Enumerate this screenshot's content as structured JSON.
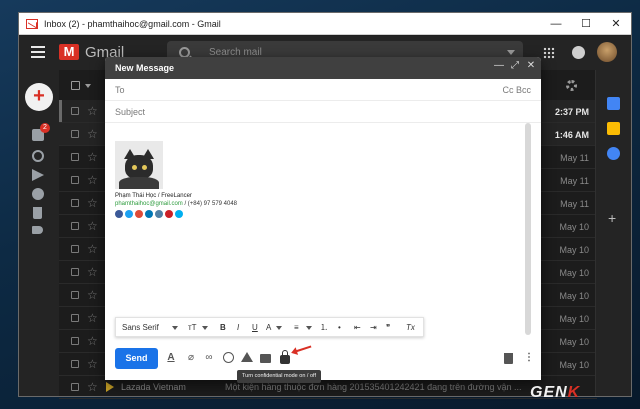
{
  "window": {
    "title": "Inbox (2) - phamthaihoc@gmail.com - Gmail"
  },
  "gmail": {
    "logo_text": "Gmail",
    "search_placeholder": "Search mail",
    "inbox_badge": "2"
  },
  "inbox": {
    "rows": [
      {
        "date": "2:37 PM",
        "unread": true
      },
      {
        "date": "1:46 AM",
        "unread": true
      },
      {
        "date": "May 11",
        "unread": false
      },
      {
        "date": "May 11",
        "unread": false
      },
      {
        "date": "May 11",
        "unread": false
      },
      {
        "date": "May 10",
        "unread": false
      },
      {
        "date": "May 10",
        "unread": false
      },
      {
        "date": "May 10",
        "unread": false
      },
      {
        "date": "May 10",
        "unread": false
      },
      {
        "date": "May 10",
        "unread": false
      },
      {
        "date": "May 10",
        "unread": false
      },
      {
        "date": "May 10",
        "unread": false
      }
    ],
    "last_row": {
      "sender": "Lazada Vietnam",
      "subject": "Một kiện hàng thuộc đơn hàng 201535401242421 đang trên đường vận ..."
    }
  },
  "compose": {
    "title": "New Message",
    "to_label": "To",
    "cc_bcc": "Cc Bcc",
    "subject_label": "Subject",
    "signature": {
      "name": "Phạm Thái Học / FreeLancer",
      "email": "phamthaihoc@gmail.com",
      "phone": " / (+84) 97 579 4048",
      "socials": [
        {
          "name": "facebook",
          "color": "#3b5998"
        },
        {
          "name": "twitter",
          "color": "#1da1f2"
        },
        {
          "name": "google-plus",
          "color": "#dd4b39"
        },
        {
          "name": "linkedin",
          "color": "#0077b5"
        },
        {
          "name": "instagram",
          "color": "#517fa4"
        },
        {
          "name": "pinterest",
          "color": "#cb2027"
        },
        {
          "name": "skype",
          "color": "#00aff0"
        }
      ]
    },
    "format_bar": {
      "font": "Sans Serif",
      "size_icon": "тT",
      "bold": "B",
      "italic": "I",
      "underline": "U",
      "text_color": "A",
      "align": "≡",
      "numbered": "⒈",
      "bulleted": "•",
      "indent_less": "⇤",
      "indent_more": "⇥",
      "quote": "❞",
      "clear": "Tx"
    },
    "send_label": "Send",
    "more": "⋮",
    "tooltip": "Turn confidential mode on / off"
  },
  "watermark": {
    "prefix": "GEN",
    "suffix": "K"
  }
}
